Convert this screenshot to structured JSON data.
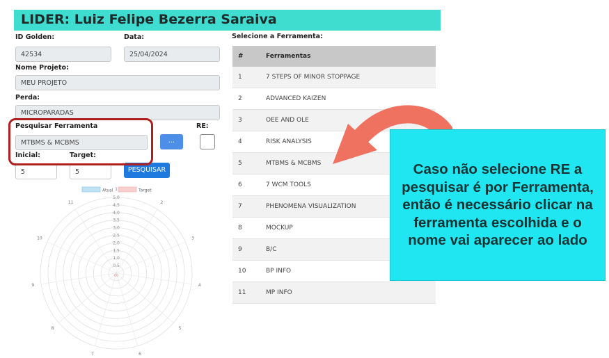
{
  "header": {
    "title": "LIDER: Luiz Felipe Bezerra Saraiva"
  },
  "form": {
    "id_golden_label": "ID Golden:",
    "id_golden_value": "42534",
    "data_label": "Data:",
    "data_value": "25/04/2024",
    "nome_projeto_label": "Nome Projeto:",
    "nome_projeto_value": "MEU PROJETO",
    "perda_label": "Perda:",
    "perda_value": "MICROPARADAS",
    "pesquisar_label": "Pesquisar Ferramenta",
    "pesquisar_value": "MTBMS & MCBMS",
    "re_label": "RE:",
    "dots_button": "...",
    "inicial_label": "Inicial:",
    "inicial_value": "5",
    "target_label": "Target:",
    "target_value": "5",
    "pesquisar_button": "PESQUISAR"
  },
  "chart_data": {
    "type": "radar",
    "legend": [
      "Atual",
      "Target"
    ],
    "legend_colors": {
      "Atual": "#bfe3f5",
      "Target": "#f8d0d0"
    },
    "axes": [
      "1",
      "2",
      "3",
      "4",
      "5",
      "6",
      "7",
      "8",
      "9",
      "10",
      "11"
    ],
    "rlim": [
      0,
      5
    ],
    "ticks": [
      "0,5",
      "1,0",
      "1,5",
      "2,0",
      "2,5",
      "3,0",
      "3,5",
      "4,0",
      "4,5",
      "5,0"
    ],
    "center_label": "00",
    "series": [
      {
        "name": "Atual",
        "values": []
      },
      {
        "name": "Target",
        "values": []
      }
    ]
  },
  "table": {
    "caption": "Selecione a Ferramenta:",
    "headers": [
      "#",
      "Ferramentas"
    ],
    "rows": [
      {
        "num": "1",
        "name": "7 STEPS OF MINOR STOPPAGE"
      },
      {
        "num": "2",
        "name": "ADVANCED KAIZEN"
      },
      {
        "num": "3",
        "name": "OEE AND OLE"
      },
      {
        "num": "4",
        "name": "RISK ANALYSIS"
      },
      {
        "num": "5",
        "name": "MTBMS & MCBMS"
      },
      {
        "num": "6",
        "name": "7 WCM TOOLS"
      },
      {
        "num": "7",
        "name": "PHENOMENA VISUALIZATION"
      },
      {
        "num": "8",
        "name": "MOCKUP"
      },
      {
        "num": "9",
        "name": "B/C"
      },
      {
        "num": "10",
        "name": "BP INFO"
      },
      {
        "num": "11",
        "name": "MP INFO"
      }
    ]
  },
  "callout": {
    "text": "Caso não selecione RE a pesquisar é por Ferramenta, então é necessário clicar na ferramenta escolhida e o nome vai aparecer ao lado"
  },
  "colors": {
    "header": "#3fdcd0",
    "callout": "#1fe6f0",
    "arrow": "#ef7261",
    "highlight": "#b01f1f",
    "primary_button": "#1f7ae0"
  }
}
